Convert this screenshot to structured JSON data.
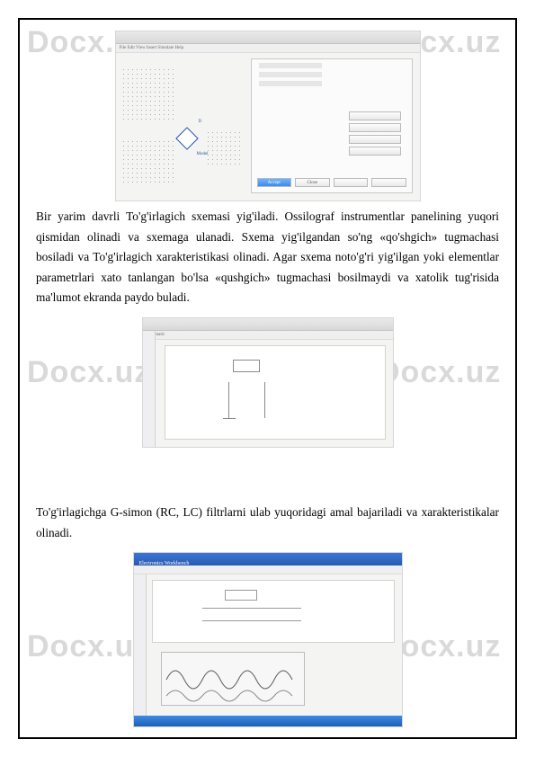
{
  "watermark": "Docx.uz",
  "paragraphs": {
    "p1": "Bir yarim davrli To'g'irlagich sxemasi yig'iladi. Ossilograf instrumentlar panelining yuqori qismidan olinadi va sxemaga ulanadi. Sxema yig'ilgandan so'ng «qo'shgich» tugmachasi bosiladi va To'g'irlagich xarakteristikasi olinadi. Agar sxema noto'g'ri yig'ilgan yoki elementlar parametrlari xato tanlangan bo'lsa «qushgich» tugmachasi bosilmaydi va xatolik tug'risida ma'lumot ekranda paydo buladi.",
    "p2": "To'g'irlagichga G-simon (RC, LC) filtrlarni ulab yuqoridagi amal bajariladi va xarakteristikalar olinadi."
  },
  "shot1": {
    "toolbar_mock": "File  Edit  View  Insert  Simulate  Help",
    "dialog_btn_ok": "Accept",
    "dialog_btn_close": "Close"
  },
  "shot2": {
    "title_mock": "Schematic"
  },
  "shot3": {
    "title_mock": "Electronics Workbench"
  }
}
